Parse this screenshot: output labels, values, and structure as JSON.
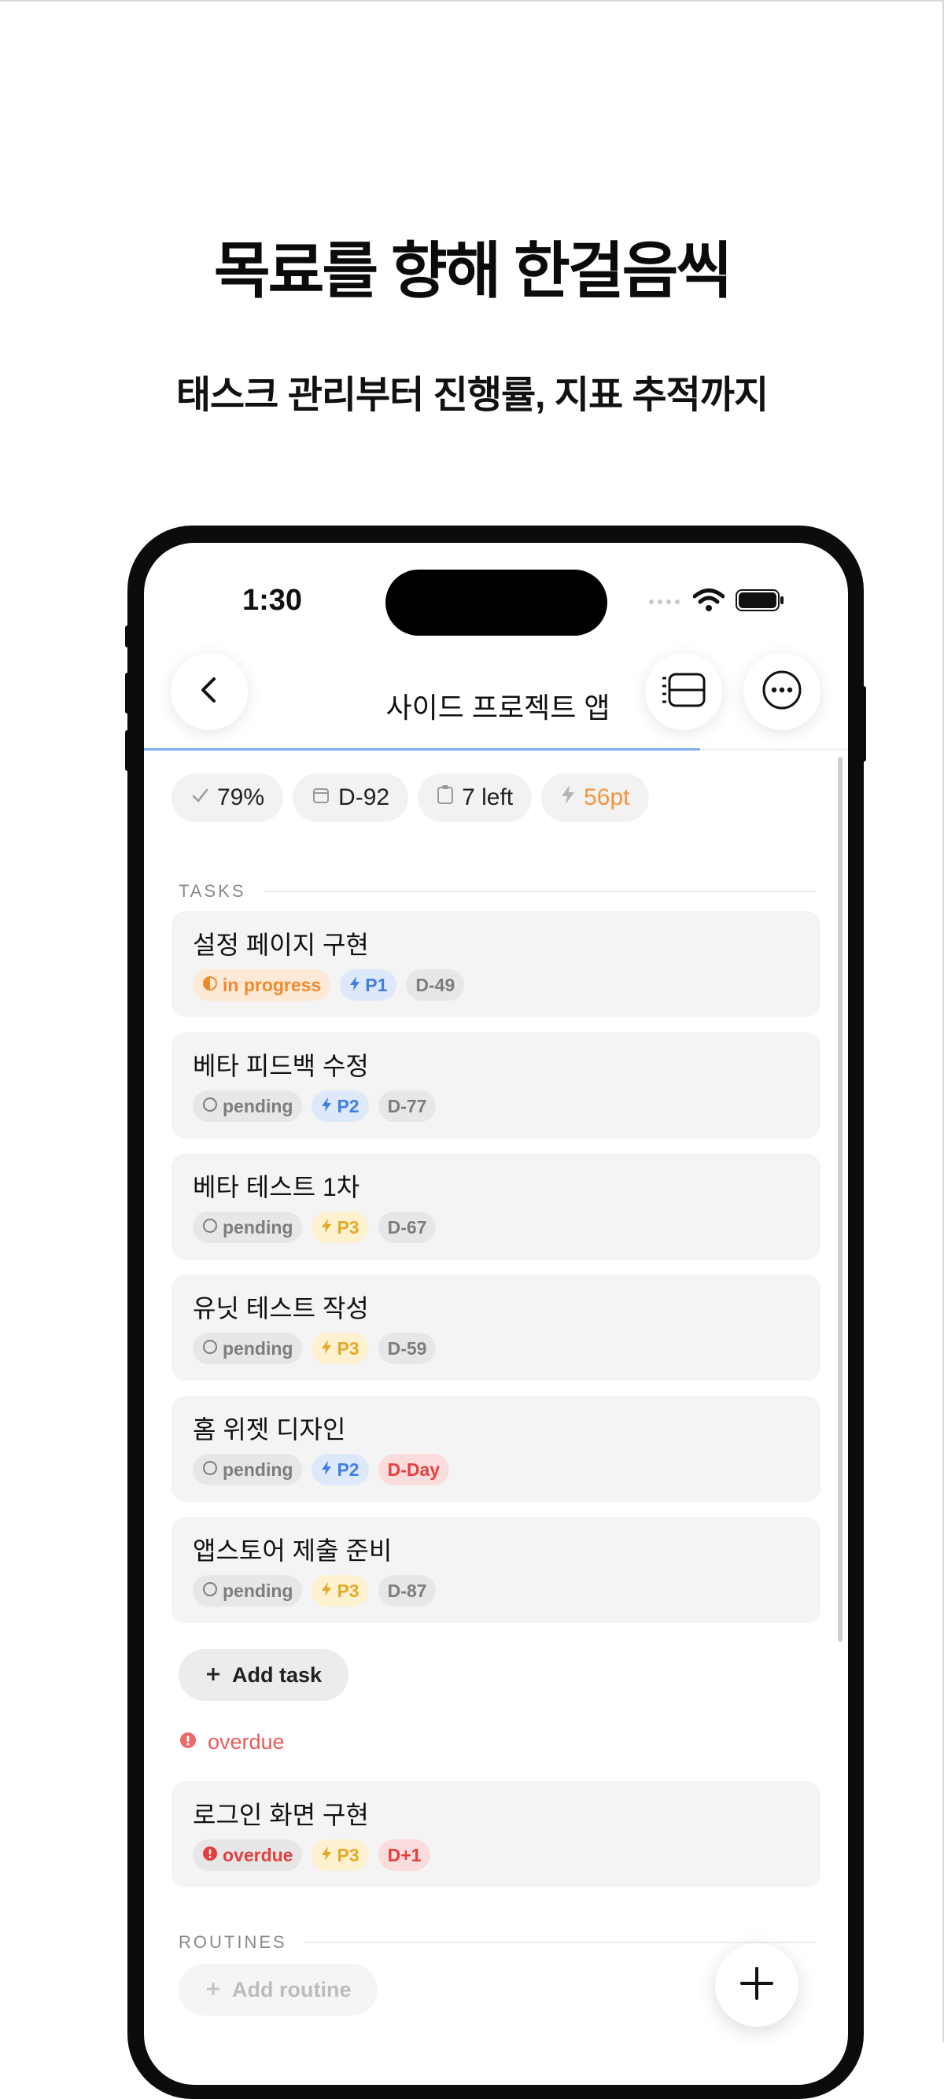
{
  "promo": {
    "headline": "목료를 향해 한걸음씩",
    "subheadline": "태스크 관리부터 진행률, 지표 추적까지"
  },
  "status_bar": {
    "time": "1:30"
  },
  "nav": {
    "title": "사이드 프로젝트 앱",
    "progress_fraction": 0.79
  },
  "summary_chips": [
    {
      "icon": "check-icon",
      "label": "79%"
    },
    {
      "icon": "calendar-icon",
      "label": "D-92"
    },
    {
      "icon": "clipboard-icon",
      "label": "7 left"
    },
    {
      "icon": "bolt-icon",
      "label": "56pt",
      "color": "#f0963a"
    }
  ],
  "tasks_section": {
    "label": "TASKS"
  },
  "tasks": [
    {
      "title": "설정 페이지 구현",
      "status": "in progress",
      "priority": "P1",
      "due": "D-49"
    },
    {
      "title": "베타 피드백 수정",
      "status": "pending",
      "priority": "P2",
      "due": "D-77"
    },
    {
      "title": "베타 테스트 1차",
      "status": "pending",
      "priority": "P3",
      "due": "D-67"
    },
    {
      "title": "유닛 테스트 작성",
      "status": "pending",
      "priority": "P3",
      "due": "D-59"
    },
    {
      "title": "홈 위젯 디자인",
      "status": "pending",
      "priority": "P2",
      "due": "D-Day"
    },
    {
      "title": "앱스토어 제출 준비",
      "status": "pending",
      "priority": "P3",
      "due": "D-87"
    }
  ],
  "add_task": {
    "label": "Add task"
  },
  "overdue_section": {
    "label": "overdue"
  },
  "overdue_tasks": [
    {
      "title": "로그인 화면 구현",
      "status": "overdue",
      "priority": "P3",
      "due": "D+1"
    }
  ],
  "routines_section": {
    "label": "ROUTINES"
  },
  "add_routine": {
    "label": "Add routine"
  },
  "colors": {
    "accent_blue": "#7eb3f3",
    "in_progress": "#ef8a2c",
    "p1_p2": "#3f7fe0",
    "p3": "#e4aa25",
    "overdue": "#e33f3f"
  }
}
